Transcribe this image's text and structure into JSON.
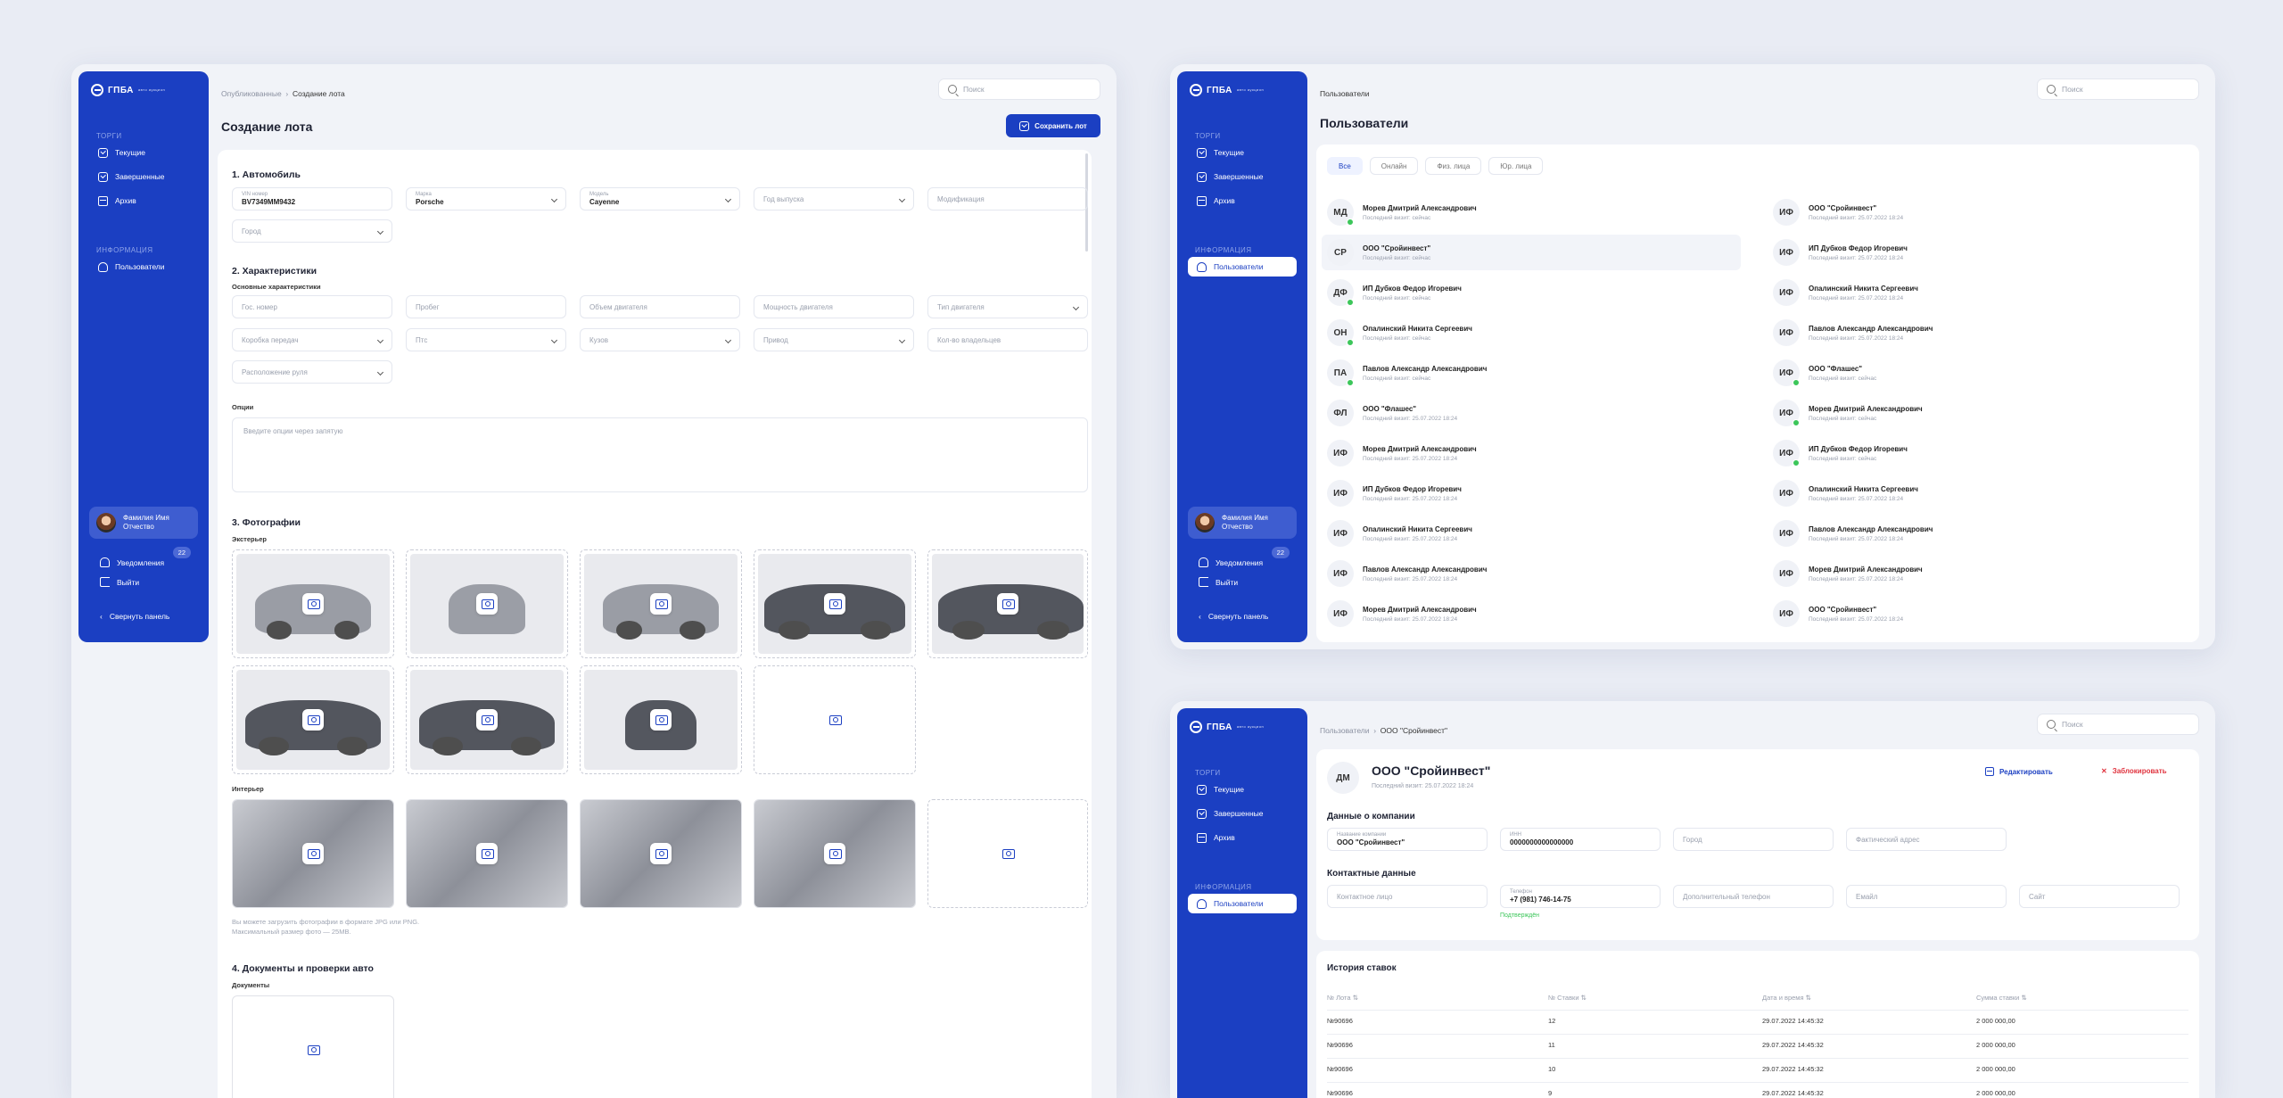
{
  "common": {
    "logo": "ГПБА",
    "logo_sub": "авто аукцион",
    "section_torgi": "ТОРГИ",
    "section_info": "ИНФОРМАЦИЯ",
    "nav": {
      "current": "Текущие",
      "finished": "Завершенные",
      "archive": "Архив",
      "users": "Пользователи"
    },
    "profile": {
      "line1": "Фамилия Имя",
      "line2": "Отчество"
    },
    "notifications": "Уведомления",
    "notif_count": "22",
    "logout": "Выйти",
    "collapse": "Свернуть панель",
    "search_placeholder": "Поиск"
  },
  "lot": {
    "breadcrumb": [
      "Опубликованные",
      "Создание лота"
    ],
    "title": "Создание лота",
    "save": "Сохранить лот",
    "s1": "1. Автомобиль",
    "vin_label": "VIN номер",
    "vin": "BV7349MM9432",
    "make_label": "Марка",
    "make": "Porsche",
    "model_label": "Модель",
    "model": "Cayenne",
    "year": "Год выпуска",
    "mod": "Модификация",
    "city": "Город",
    "s2": "2. Характеристики",
    "s2sub": "Основные характеристики",
    "f": [
      "Гос. номер",
      "Пробег",
      "Объем двигателя",
      "Мощность двигателя",
      "Тип двигателя",
      "Коробка передач",
      "Птс",
      "Кузов",
      "Привод",
      "Кол-во владельцев",
      "Расположение руля"
    ],
    "opts": "Опции",
    "opts_ph": "Введите опции через запятую",
    "s3": "3. Фотографии",
    "ext": "Экстерьер",
    "int": "Интерьер",
    "note1": "Вы можете загрузить фотографии в формате JPG или PNG.",
    "note2": "Максимальный размер фото — 25MB.",
    "s4": "4. Документы и проверки авто",
    "docs": "Документы"
  },
  "users": {
    "breadcrumb": "Пользователи",
    "title": "Пользователи",
    "tabs": [
      "Все",
      "Онлайн",
      "Физ. лица",
      "Юр. лица"
    ],
    "left": [
      {
        "i": "МД",
        "n": "Морев Дмитрий Александрович",
        "s": "Последний визит: сейчас",
        "on": true
      },
      {
        "i": "СР",
        "n": "ООО \"Сройинвест\"",
        "s": "Последний визит: сейчас",
        "on": false
      },
      {
        "i": "ДФ",
        "n": "ИП Дубков Федор Игоревич",
        "s": "Последний визит: сейчас",
        "on": true
      },
      {
        "i": "ОН",
        "n": "Опалинский Никита Сергеевич",
        "s": "Последний визит: сейчас",
        "on": true
      },
      {
        "i": "ПА",
        "n": "Павлов Александр Александрович",
        "s": "Последний визит: сейчас",
        "on": true
      },
      {
        "i": "ФЛ",
        "n": "ООО \"Флашес\"",
        "s": "Последний визит: 25.07.2022 18:24",
        "on": false
      },
      {
        "i": "ИФ",
        "n": "Морев Дмитрий Александрович",
        "s": "Последний визит: 25.07.2022 18:24",
        "on": false
      },
      {
        "i": "ИФ",
        "n": "ИП Дубков Федор Игоревич",
        "s": "Последний визит: 25.07.2022 18:24",
        "on": false
      },
      {
        "i": "ИФ",
        "n": "Опалинский Никита Сергеевич",
        "s": "Последний визит: 25.07.2022 18:24",
        "on": false
      },
      {
        "i": "ИФ",
        "n": "Павлов Александр Александрович",
        "s": "Последний визит: 25.07.2022 18:24",
        "on": false
      },
      {
        "i": "ИФ",
        "n": "Морев Дмитрий Александрович",
        "s": "Последний визит: 25.07.2022 18:24",
        "on": false
      }
    ],
    "right": [
      {
        "i": "ИФ",
        "n": "ООО \"Сройинвест\"",
        "s": "Последний визит: 25.07.2022 18:24",
        "on": false
      },
      {
        "i": "ИФ",
        "n": "ИП Дубков Федор Игоревич",
        "s": "Последний визит: 25.07.2022 18:24",
        "on": false
      },
      {
        "i": "ИФ",
        "n": "Опалинский Никита Сергеевич",
        "s": "Последний визит: 25.07.2022 18:24",
        "on": false
      },
      {
        "i": "ИФ",
        "n": "Павлов Александр Александрович",
        "s": "Последний визит: 25.07.2022 18:24",
        "on": false
      },
      {
        "i": "ИФ",
        "n": "ООО \"Флашес\"",
        "s": "Последний визит: сейчас",
        "on": true
      },
      {
        "i": "ИФ",
        "n": "Морев Дмитрий Александрович",
        "s": "Последний визит: сейчас",
        "on": true
      },
      {
        "i": "ИФ",
        "n": "ИП Дубков Федор Игоревич",
        "s": "Последний визит: сейчас",
        "on": true
      },
      {
        "i": "ИФ",
        "n": "Опалинский Никита Сергеевич",
        "s": "Последний визит: 25.07.2022 18:24",
        "on": false
      },
      {
        "i": "ИФ",
        "n": "Павлов Александр Александрович",
        "s": "Последний визит: 25.07.2022 18:24",
        "on": false
      },
      {
        "i": "ИФ",
        "n": "Морев Дмитрий Александрович",
        "s": "Последний визит: 25.07.2022 18:24",
        "on": false
      },
      {
        "i": "ИФ",
        "n": "ООО \"Сройинвест\"",
        "s": "Последний визит: 25.07.2022 18:24",
        "on": false
      }
    ]
  },
  "company": {
    "breadcrumb": [
      "Пользователи",
      "ООО \"Сройинвест\""
    ],
    "initials": "ДМ",
    "name": "ООО \"Сройинвест\"",
    "visit": "Последний визит: 25.07.2022 18:24",
    "edit": "Редактировать",
    "block": "Заблокировать",
    "sec1": "Данные о компании",
    "cname_label": "Название компании",
    "cname": "ООО \"Сройинвест\"",
    "inn_label": "ИНН",
    "inn": "0000000000000000",
    "city": "Город",
    "addr": "Фактический адрес",
    "sec2": "Контактные данные",
    "contact": "Контактное лицо",
    "phone_label": "Телефон",
    "phone": "+7 (981) 746-14-75",
    "confirmed": "Подтверждён",
    "phone2": "Дополнительный телефон",
    "email": "Емайл",
    "site": "Сайт",
    "history": "История ставок",
    "cols": [
      "№ Лота",
      "№ Ставки",
      "Дата и время",
      "Сумма ставки"
    ],
    "rows": [
      [
        "№90696",
        "12",
        "29.07.2022 14:45:32",
        "2 000 000,00"
      ],
      [
        "№90696",
        "11",
        "29.07.2022 14:45:32",
        "2 000 000,00"
      ],
      [
        "№90696",
        "10",
        "29.07.2022 14:45:32",
        "2 000 000,00"
      ],
      [
        "№90696",
        "9",
        "29.07.2022 14:45:32",
        "2 000 000,00"
      ]
    ]
  },
  "colors": {
    "accent": "#1b3fc2",
    "online": "#3cc65a",
    "danger": "#e0343f"
  }
}
